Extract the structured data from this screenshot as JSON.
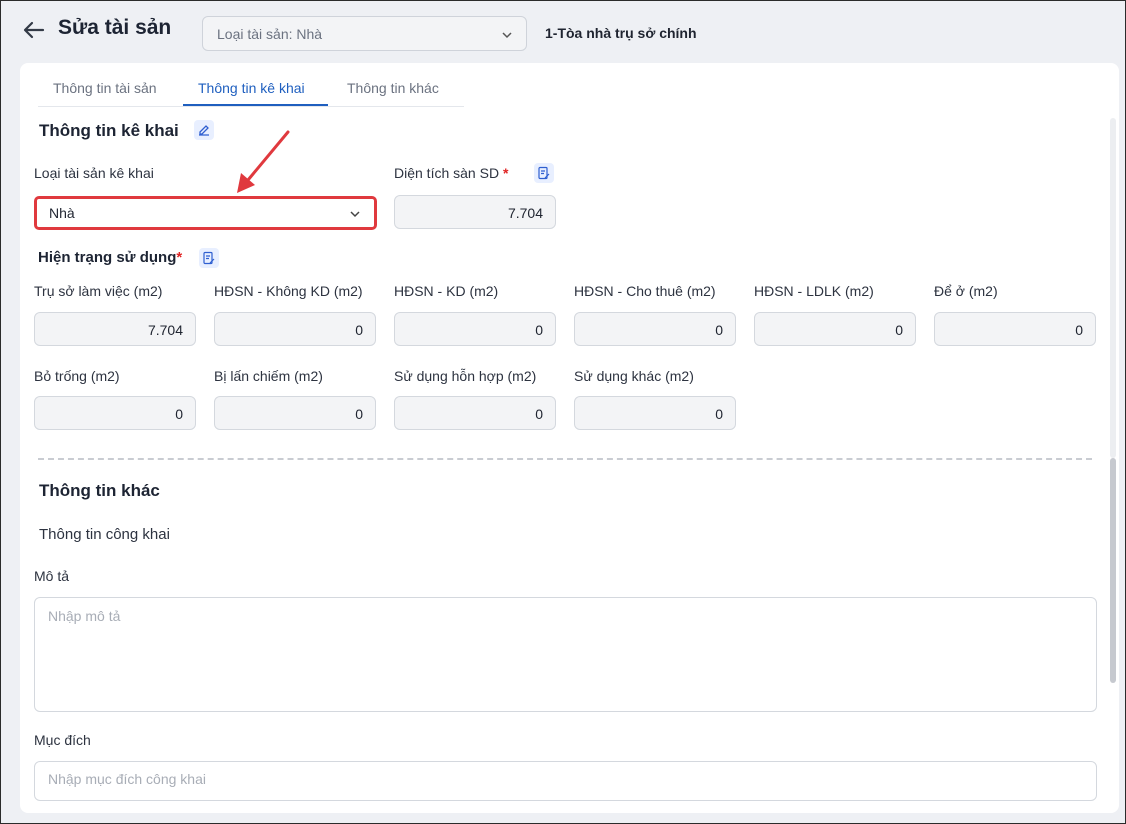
{
  "header": {
    "title": "Sửa tài sản",
    "asset_type_select": "Loại tài sản: Nhà",
    "asset_name": "1-Tòa nhà trụ sở chính"
  },
  "tabs": [
    {
      "label": "Thông tin tài sản"
    },
    {
      "label": "Thông tin kê khai"
    },
    {
      "label": "Thông tin khác"
    }
  ],
  "declaration": {
    "title": "Thông tin kê khai",
    "asset_type_label": "Loại tài sản kê khai",
    "asset_type_value": "Nhà",
    "floor_area_label": "Diện tích sàn SD",
    "floor_area_required": "*",
    "floor_area_value": "7.704"
  },
  "usage": {
    "title": "Hiện trạng sử dụng",
    "required": "*",
    "fields": [
      {
        "label": "Trụ sở làm việc (m2)",
        "value": "7.704"
      },
      {
        "label": "HĐSN - Không KD (m2)",
        "value": "0"
      },
      {
        "label": "HĐSN - KD (m2)",
        "value": "0"
      },
      {
        "label": "HĐSN - Cho thuê (m2)",
        "value": "0"
      },
      {
        "label": "HĐSN - LDLK (m2)",
        "value": "0"
      },
      {
        "label": "Để ở (m2)",
        "value": "0"
      },
      {
        "label": "Bỏ trống (m2)",
        "value": "0"
      },
      {
        "label": "Bị lấn chiếm (m2)",
        "value": "0"
      },
      {
        "label": "Sử dụng hỗn hợp (m2)",
        "value": "0"
      },
      {
        "label": "Sử dụng khác (m2)",
        "value": "0"
      }
    ]
  },
  "other": {
    "title": "Thông tin khác",
    "public_info": "Thông tin công khai",
    "description_label": "Mô tả",
    "description_placeholder": "Nhập mô tả",
    "purpose_label": "Mục đích",
    "purpose_placeholder": "Nhập mục đích công khai"
  },
  "colors": {
    "accent": "#1f5fbf",
    "highlight_border": "#e0393e",
    "required": "#e02424"
  }
}
